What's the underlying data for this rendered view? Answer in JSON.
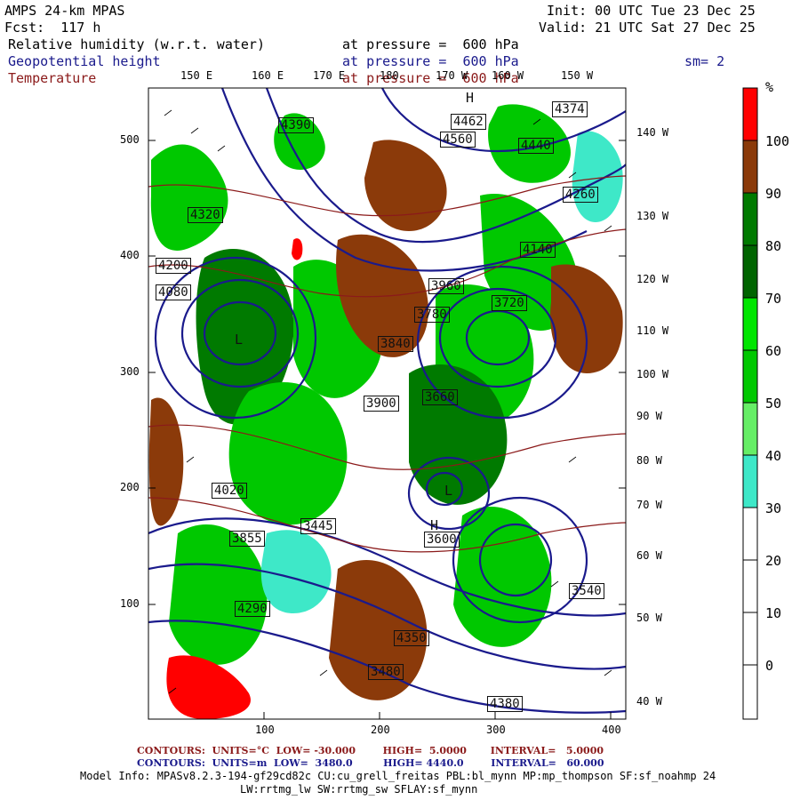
{
  "header": {
    "model_title": "AMPS 24-km MPAS",
    "fcst": "Fcst:  117 h",
    "init": "Init: 00 UTC Tue 23 Dec 25",
    "valid": "Valid: 21 UTC Sat 27 Dec 25",
    "sm": "sm= 2",
    "fields": [
      {
        "name": "Relative humidity (w.r.t. water)",
        "level": "at pressure =  600 hPa",
        "color": "#000000"
      },
      {
        "name": "Geopotential height",
        "level": "at pressure =  600 hPa",
        "color": "#1a1a8c"
      },
      {
        "name": "Temperature",
        "level": "at pressure =  600 hPa",
        "color": "#8b1a1a"
      }
    ]
  },
  "map": {
    "top_lon_labels": [
      "150 E",
      "160 E",
      "170 E",
      "180",
      "170 W",
      "160 W",
      "150 W"
    ],
    "right_lon_labels": [
      "140 W",
      "130 W",
      "120 W",
      "110 W",
      "100 W",
      "90 W",
      "80 W",
      "70 W",
      "60 W",
      "50 W",
      "40 W"
    ],
    "y_ticks": [
      "500",
      "400",
      "300",
      "200",
      "100"
    ],
    "x_ticks": [
      "100",
      "200",
      "300",
      "400"
    ],
    "height_labels": [
      "4462",
      "4374",
      "4440",
      "4380",
      "4320",
      "4260",
      "4200",
      "4140",
      "4080",
      "4020",
      "3960",
      "3900",
      "3840",
      "3780",
      "3720",
      "3660",
      "3600",
      "3540",
      "3480",
      "4560",
      "4290",
      "4390",
      "3855",
      "3445",
      "4350"
    ],
    "highs_lows": [
      "H",
      "H",
      "L",
      "L"
    ]
  },
  "colorbar": {
    "unit": "%",
    "labels": [
      "100",
      "90",
      "80",
      "70",
      "60",
      "50",
      "40",
      "30",
      "20",
      "10",
      "0"
    ],
    "colors": [
      "#ff0000",
      "#8b3a0a",
      "#007a00",
      "#006400",
      "#00e600",
      "#00c800",
      "#66ee66",
      "#3ee8c8",
      "#ffffff",
      "#ffffff",
      "#ffffff",
      "#ffffff"
    ]
  },
  "footer": {
    "temp_contours": "CONTOURS:  UNITS=°C  LOW= -30.000        HIGH=  5.0000       INTERVAL=   5.0000",
    "height_contours": "CONTOURS:  UNITS=m  LOW=  3480.0         HIGH= 4440.0        INTERVAL=   60.000",
    "model_info_1": "Model Info: MPASv8.2.3-194-gf29cd82c CU:cu_grell_freitas PBL:bl_mynn MP:mp_thompson SF:sf_noahmp 24",
    "model_info_2": "LW:rrtmg_lw SW:rrtmg_sw SFLAY:sf_mynn"
  }
}
